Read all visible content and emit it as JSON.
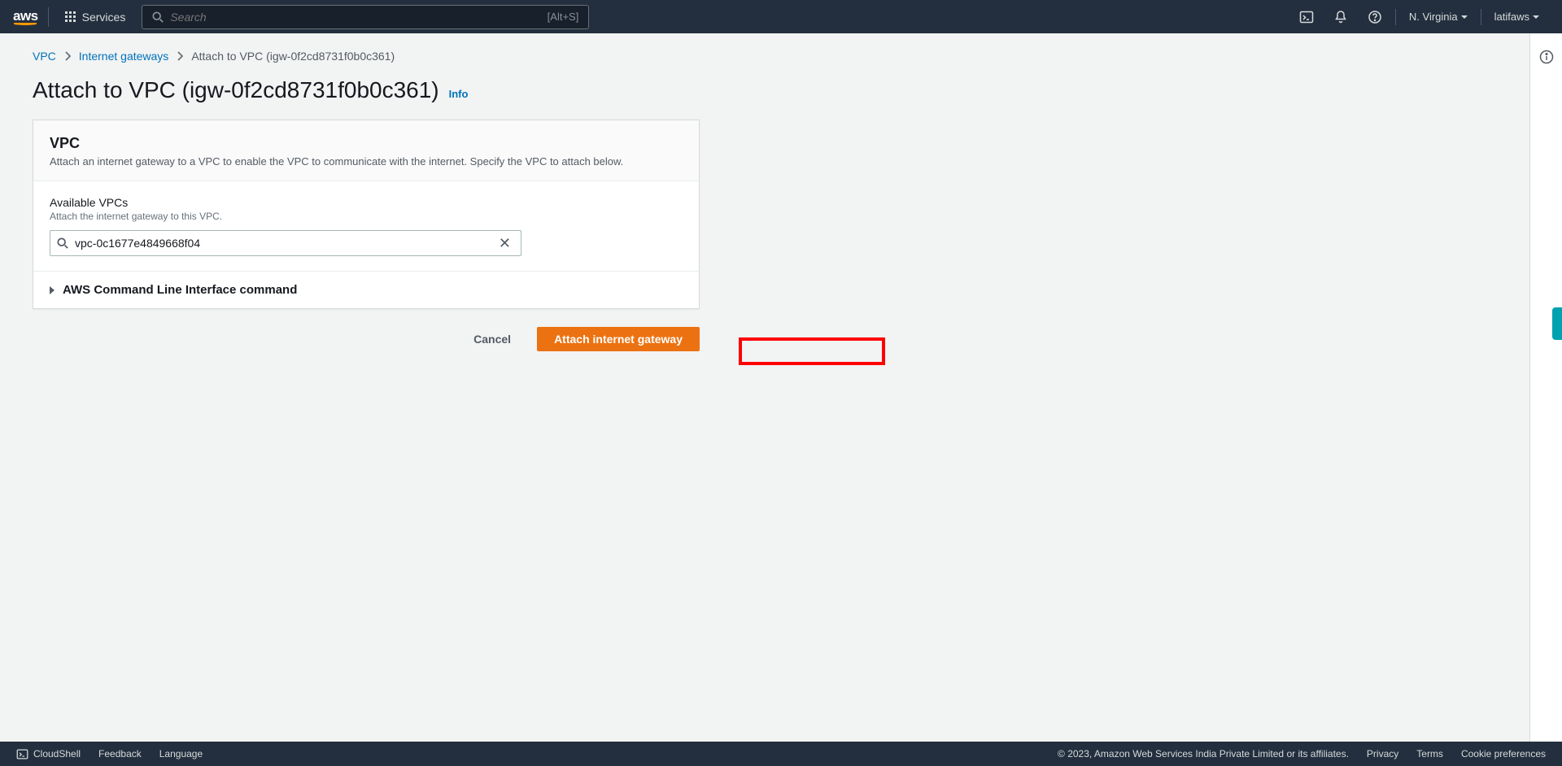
{
  "nav": {
    "logo_text": "aws",
    "services": "Services",
    "search_placeholder": "Search",
    "search_kbd": "[Alt+S]",
    "region": "N. Virginia",
    "user": "latifaws"
  },
  "breadcrumbs": {
    "root": "VPC",
    "mid": "Internet gateways",
    "current": "Attach to VPC (igw-0f2cd8731f0b0c361)"
  },
  "page": {
    "title": "Attach to VPC (igw-0f2cd8731f0b0c361)",
    "info": "Info"
  },
  "panel": {
    "title": "VPC",
    "desc": "Attach an internet gateway to a VPC to enable the VPC to communicate with the internet. Specify the VPC to attach below.",
    "field_label": "Available VPCs",
    "field_hint": "Attach the internet gateway to this VPC.",
    "vpc_value": "vpc-0c1677e4849668f04",
    "cli_label": "AWS Command Line Interface command"
  },
  "actions": {
    "cancel": "Cancel",
    "submit": "Attach internet gateway"
  },
  "footer": {
    "cloudshell": "CloudShell",
    "feedback": "Feedback",
    "language": "Language",
    "copyright": "© 2023, Amazon Web Services India Private Limited or its affiliates.",
    "privacy": "Privacy",
    "terms": "Terms",
    "cookies": "Cookie preferences"
  }
}
